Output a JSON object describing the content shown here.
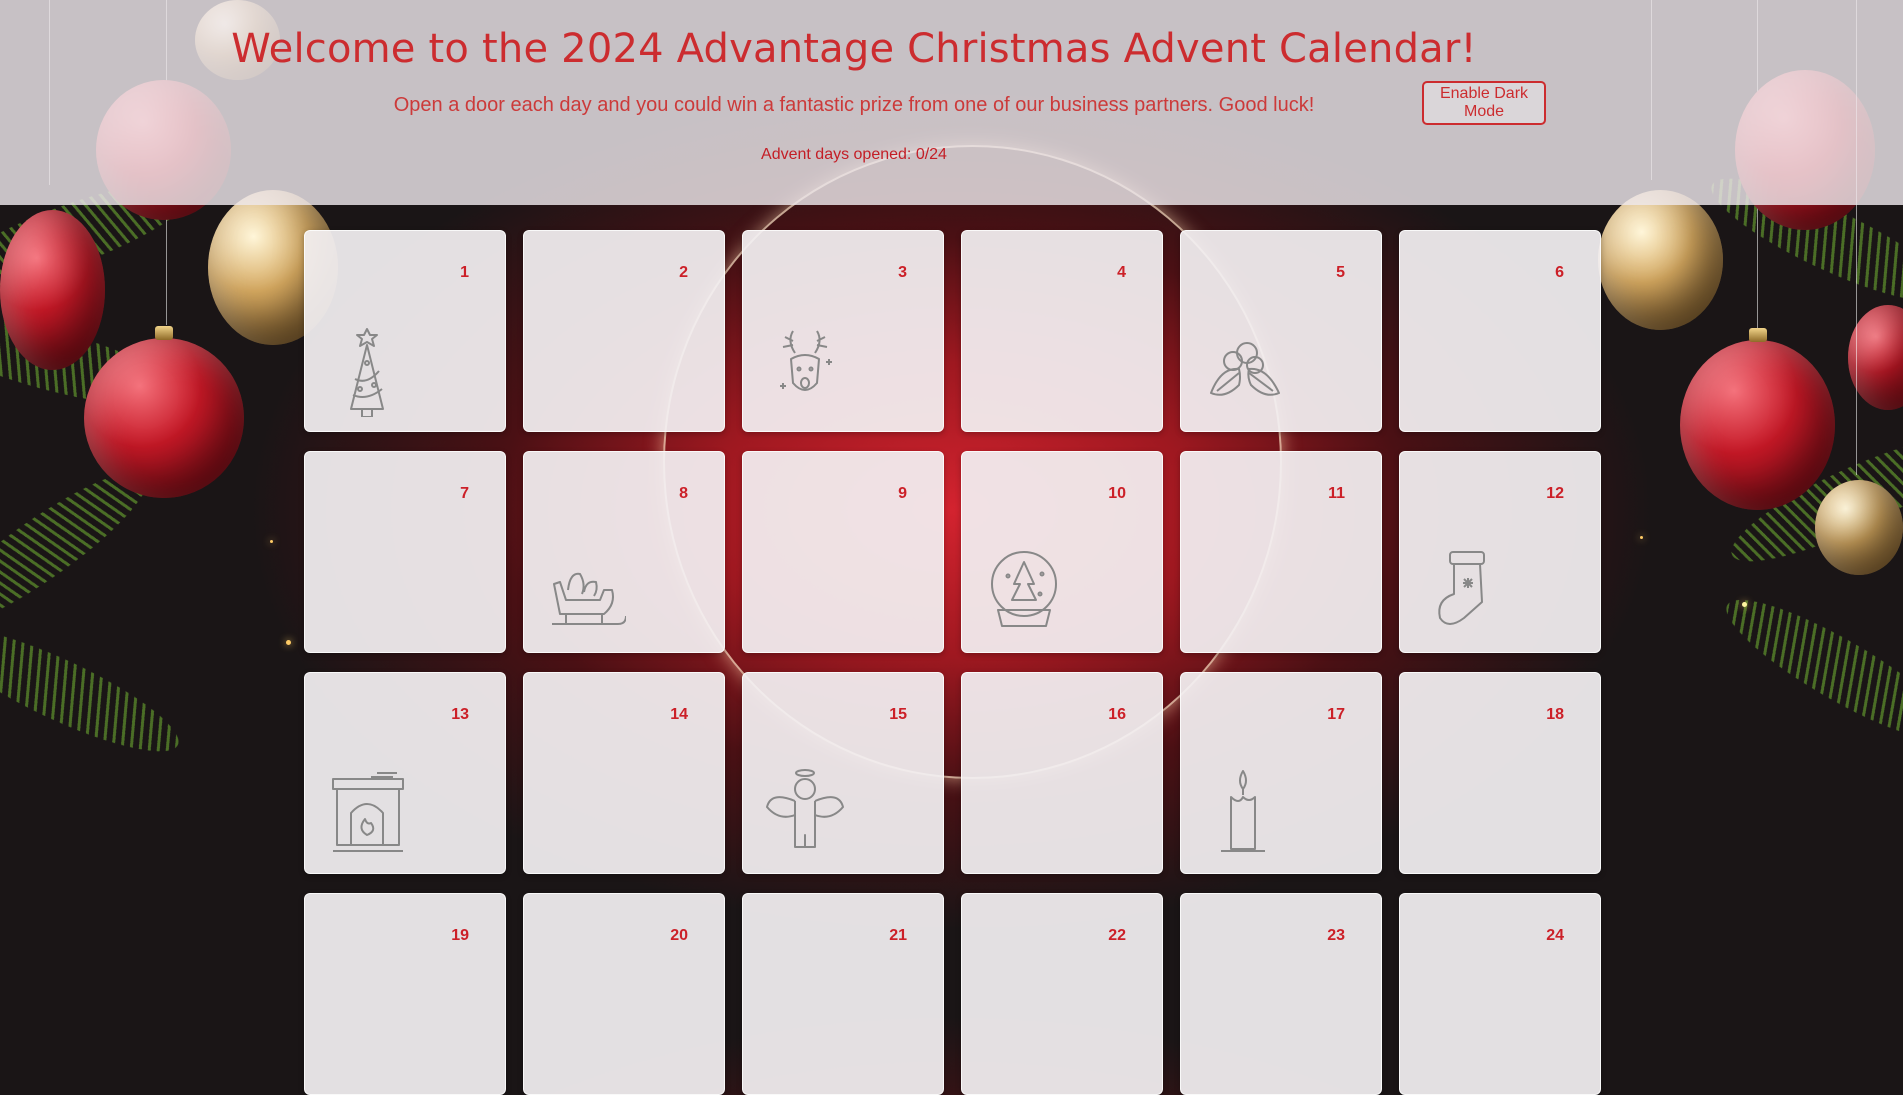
{
  "header": {
    "title": "Welcome to the 2024 Advantage Christmas Advent Calendar!",
    "subtitle": "Open a door each day and you could win a fantastic prize from one of our business partners. Good luck!",
    "progress": "Advent days opened: 0/24",
    "dark_mode_label": "Enable Dark Mode"
  },
  "colors": {
    "accent": "#cc2c2f",
    "door_bg": "#f3f0f2",
    "header_bg": "#eee8ec"
  },
  "doors": [
    {
      "number": "1",
      "icon": "christmas-tree-icon"
    },
    {
      "number": "2",
      "icon": ""
    },
    {
      "number": "3",
      "icon": "reindeer-icon"
    },
    {
      "number": "4",
      "icon": ""
    },
    {
      "number": "5",
      "icon": "holly-icon"
    },
    {
      "number": "6",
      "icon": ""
    },
    {
      "number": "7",
      "icon": ""
    },
    {
      "number": "8",
      "icon": "sleigh-icon"
    },
    {
      "number": "9",
      "icon": ""
    },
    {
      "number": "10",
      "icon": "snow-globe-icon"
    },
    {
      "number": "11",
      "icon": ""
    },
    {
      "number": "12",
      "icon": "stocking-icon"
    },
    {
      "number": "13",
      "icon": "fireplace-icon"
    },
    {
      "number": "14",
      "icon": ""
    },
    {
      "number": "15",
      "icon": "angel-icon"
    },
    {
      "number": "16",
      "icon": ""
    },
    {
      "number": "17",
      "icon": "candle-icon"
    },
    {
      "number": "18",
      "icon": ""
    },
    {
      "number": "19",
      "icon": ""
    },
    {
      "number": "20",
      "icon": ""
    },
    {
      "number": "21",
      "icon": ""
    },
    {
      "number": "22",
      "icon": ""
    },
    {
      "number": "23",
      "icon": ""
    },
    {
      "number": "24",
      "icon": ""
    }
  ]
}
